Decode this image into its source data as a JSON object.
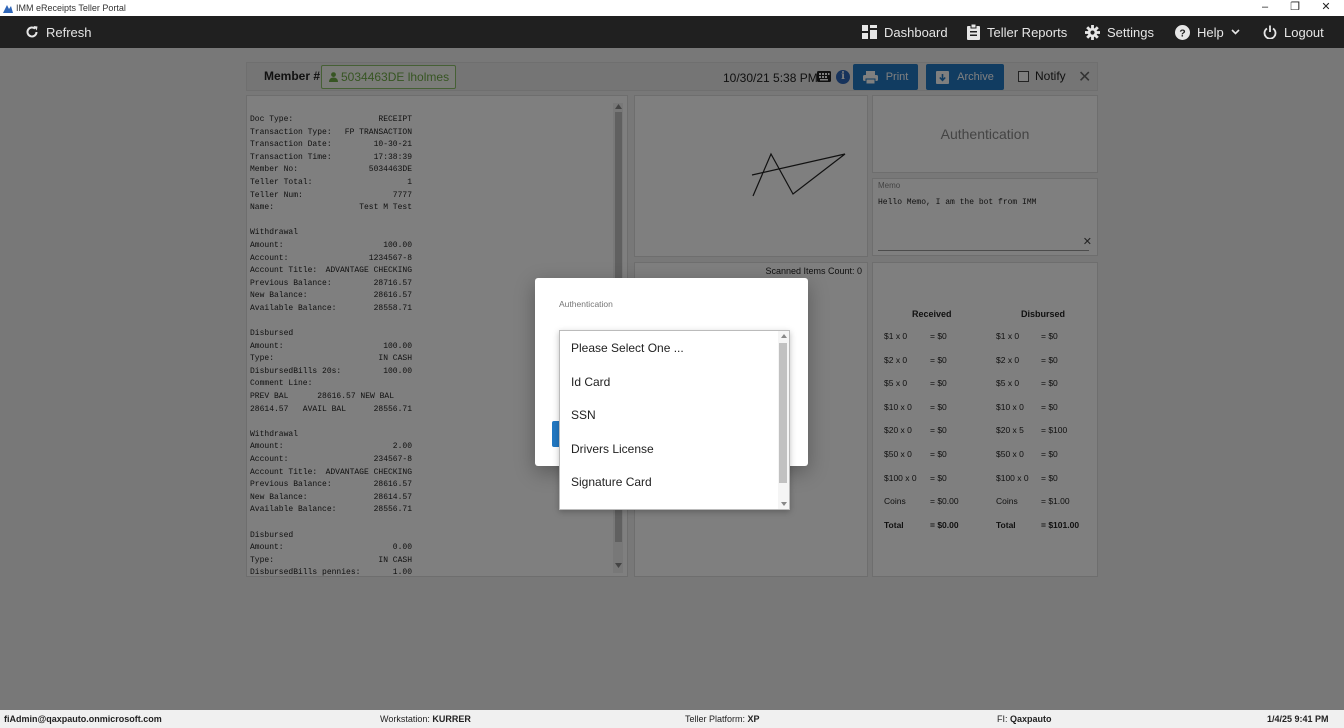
{
  "window": {
    "title": "IMM eReceipts Teller Portal",
    "controls": {
      "minimize": "–",
      "restore": "❐",
      "close": "✕"
    }
  },
  "nav": {
    "refresh": "Refresh",
    "dashboard": "Dashboard",
    "teller_reports": "Teller Reports",
    "settings": "Settings",
    "help": "Help",
    "logout": "Logout"
  },
  "member": {
    "label": "Member #:",
    "value": "5034463DE lholmes",
    "datetime": "10/30/21 5:38 PM",
    "print": "Print",
    "archive": "Archive",
    "notify": "Notify",
    "close": "✕"
  },
  "receipt": {
    "lines": [
      [
        "Doc Type:",
        "RECEIPT"
      ],
      [
        "Transaction Type:",
        "FP TRANSACTION"
      ],
      [
        "Transaction Date:",
        "10-30-21"
      ],
      [
        "Transaction Time:",
        "17:38:39"
      ],
      [
        "Member No:",
        "5034463DE"
      ],
      [
        "Teller Total:",
        "1"
      ],
      [
        "Teller Num:",
        "7777"
      ],
      [
        "Name:",
        "Test M Test"
      ],
      [
        "",
        ""
      ],
      [
        "Withdrawal",
        ""
      ],
      [
        "Amount:",
        "100.00"
      ],
      [
        "Account:",
        "1234567-8"
      ],
      [
        "Account Title:",
        "ADVANTAGE CHECKING"
      ],
      [
        "Previous Balance:",
        "28716.57"
      ],
      [
        "New Balance:",
        "28616.57"
      ],
      [
        "Available Balance:",
        "28558.71"
      ],
      [
        "",
        ""
      ],
      [
        "Disbursed",
        ""
      ],
      [
        "Amount:",
        "100.00"
      ],
      [
        "Type:",
        "IN CASH"
      ],
      [
        "DisbursedBills 20s:",
        "100.00"
      ],
      [
        "Comment Line:",
        ""
      ],
      [
        "PREV BAL      28616.57 NEW BAL",
        ""
      ],
      [
        "28614.57   AVAIL BAL",
        "28556.71"
      ],
      [
        "",
        ""
      ],
      [
        "Withdrawal",
        ""
      ],
      [
        "Amount:",
        "2.00"
      ],
      [
        "Account:",
        "234567-8"
      ],
      [
        "Account Title:",
        "ADVANTAGE CHECKING"
      ],
      [
        "Previous Balance:",
        "28616.57"
      ],
      [
        "New Balance:",
        "28614.57"
      ],
      [
        "Available Balance:",
        "28556.71"
      ],
      [
        "",
        ""
      ],
      [
        "Disbursed",
        ""
      ],
      [
        "Amount:",
        "0.00"
      ],
      [
        "Type:",
        "IN CASH"
      ],
      [
        "DisbursedBills pennies:",
        "1.00"
      ]
    ]
  },
  "scan": {
    "label": "Scanned Items Count: 0"
  },
  "auth": {
    "title": "Authentication"
  },
  "memo": {
    "label": "Memo",
    "text": "Hello Memo, I am the bot from IMM",
    "clear": "✕"
  },
  "cash": {
    "received_header": "Received",
    "disbursed_header": "Disbursed",
    "rows": [
      {
        "r_denom": "$1 x 0",
        "r_amt": "= $0",
        "d_denom": "$1 x 0",
        "d_amt": "= $0"
      },
      {
        "r_denom": "$2 x 0",
        "r_amt": "= $0",
        "d_denom": "$2 x 0",
        "d_amt": "= $0"
      },
      {
        "r_denom": "$5 x 0",
        "r_amt": "= $0",
        "d_denom": "$5 x 0",
        "d_amt": "= $0"
      },
      {
        "r_denom": "$10 x 0",
        "r_amt": "= $0",
        "d_denom": "$10 x 0",
        "d_amt": "= $0"
      },
      {
        "r_denom": "$20 x 0",
        "r_amt": "= $0",
        "d_denom": "$20 x 5",
        "d_amt": "= $100"
      },
      {
        "r_denom": "$50 x 0",
        "r_amt": "= $0",
        "d_denom": "$50 x 0",
        "d_amt": "= $0"
      },
      {
        "r_denom": "$100 x 0",
        "r_amt": "= $0",
        "d_denom": "$100 x 0",
        "d_amt": "= $0"
      },
      {
        "r_denom": "Coins",
        "r_amt": "= $0.00",
        "d_denom": "Coins",
        "d_amt": "= $1.00"
      },
      {
        "r_denom": "Total",
        "r_amt": "= $0.00",
        "d_denom": "Total",
        "d_amt": "= $101.00"
      }
    ]
  },
  "modal": {
    "label": "Authentication",
    "options": [
      "Please Select One ...",
      "Id Card",
      "SSN",
      "Drivers License",
      "Signature Card"
    ]
  },
  "status": {
    "user": "fiAdmin@qaxpauto.onmicrosoft.com",
    "workstation_label": "Workstation:",
    "workstation": "KURRER",
    "platform_label": "Teller Platform:",
    "platform": "XP",
    "fi_label": "FI:",
    "fi": "Qaxpauto",
    "datetime": "1/4/25 9:41 PM"
  }
}
